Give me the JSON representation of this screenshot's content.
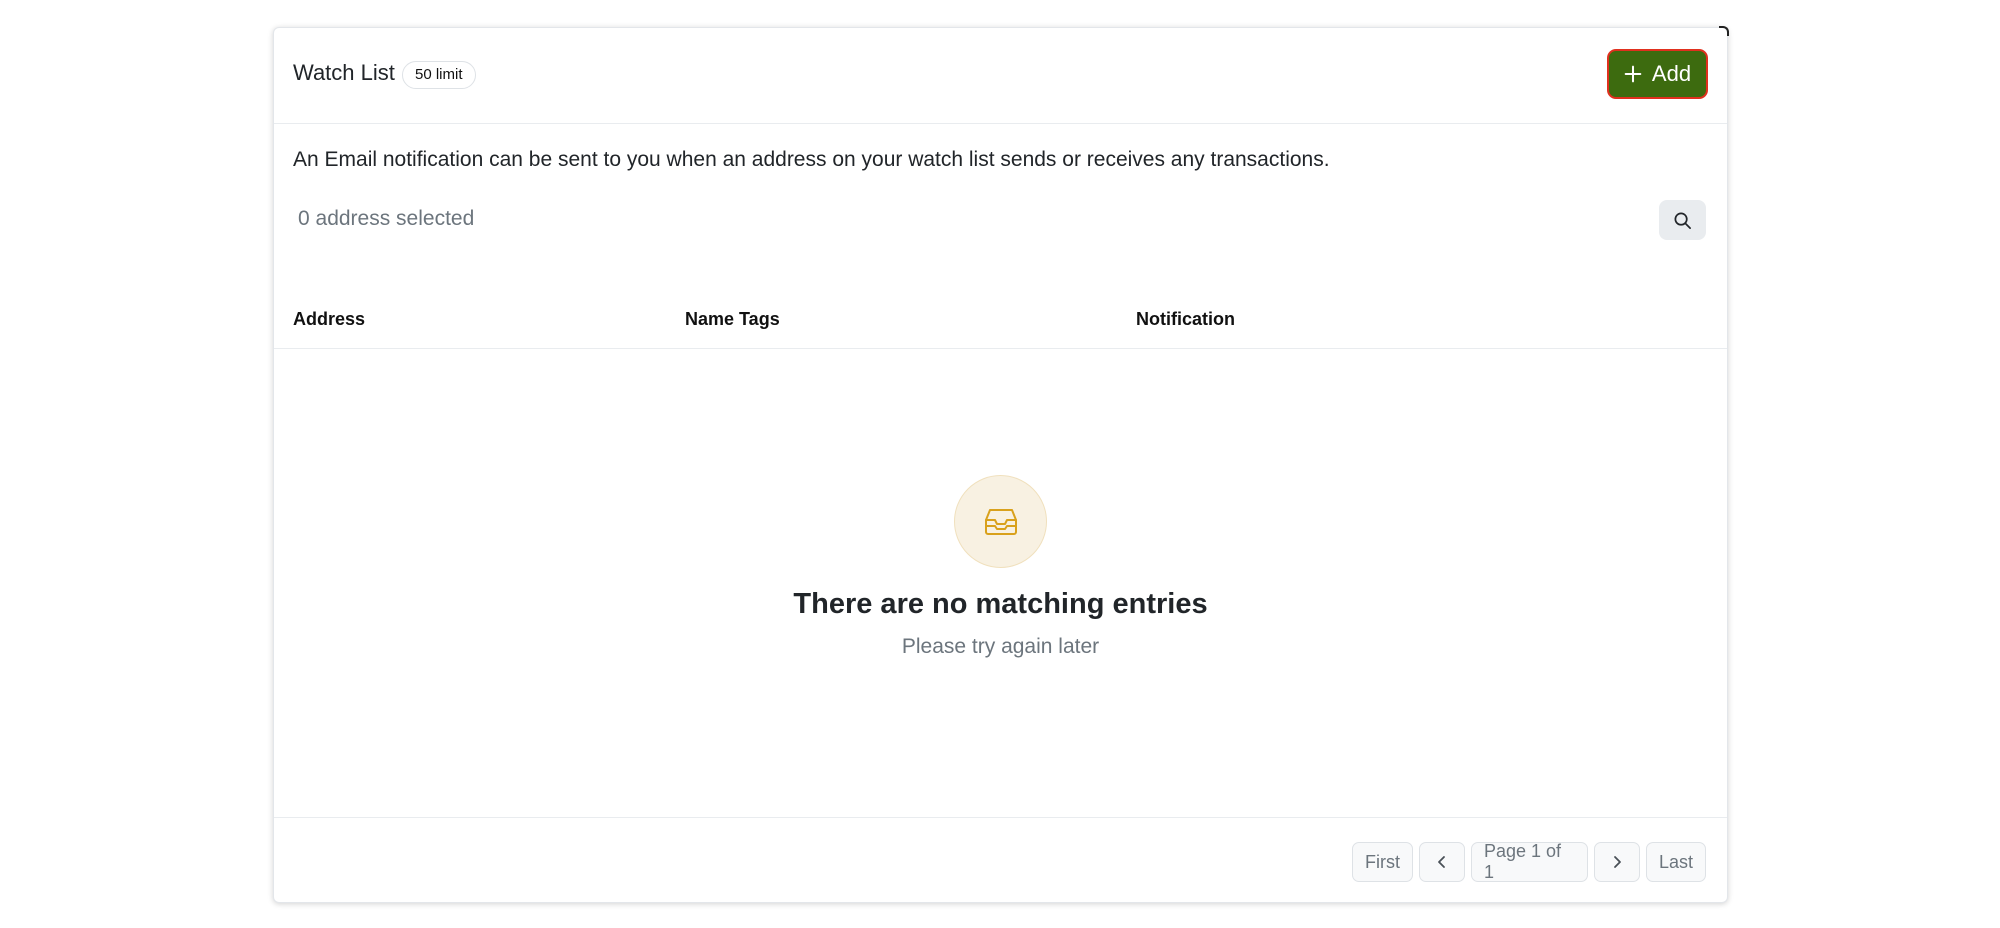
{
  "header": {
    "title": "Watch List",
    "limit_badge": "50 limit",
    "add_label": "Add"
  },
  "description": "An Email notification can be sent to you when an address on your watch list sends or receives any transactions.",
  "selection": {
    "count_text": "0 address selected"
  },
  "table": {
    "columns": [
      "Address",
      "Name Tags",
      "Notification"
    ]
  },
  "empty_state": {
    "icon": "inbox-icon",
    "title": "There are no matching entries",
    "subtitle": "Please try again later"
  },
  "pagination": {
    "first_label": "First",
    "page_info": "Page 1 of 1",
    "last_label": "Last"
  },
  "colors": {
    "add_button_bg": "#3d6b0f",
    "add_button_border": "#e0301e",
    "empty_icon": "#d9a11c"
  }
}
